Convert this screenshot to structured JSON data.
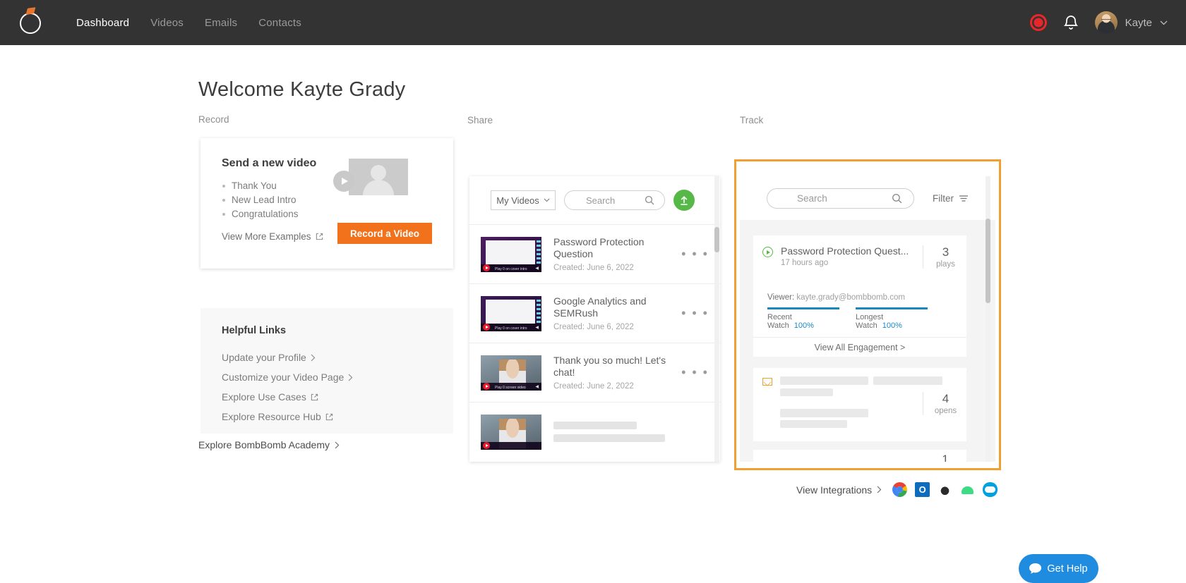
{
  "header": {
    "logo_name": "bombbomb-logo",
    "nav": [
      {
        "label": "Dashboard",
        "active": true
      },
      {
        "label": "Videos",
        "active": false
      },
      {
        "label": "Emails",
        "active": false
      },
      {
        "label": "Contacts",
        "active": false
      }
    ],
    "record_button_name": "record-button",
    "notifications_name": "notifications-bell",
    "user_name": "Kayte",
    "accent_color": "#e8272c",
    "background_color": "#333333"
  },
  "page": {
    "welcome_title": "Welcome Kayte Grady",
    "columns": {
      "record_label": "Record",
      "share_label": "Share",
      "track_label": "Track"
    }
  },
  "record": {
    "card_title": "Send a new video",
    "examples": [
      "Thank You",
      "New Lead Intro",
      "Congratulations"
    ],
    "view_more_label": "View More Examples",
    "record_button_label": "Record a Video",
    "record_button_color": "#f2721c",
    "helpful_links_title": "Helpful Links",
    "helpful_links": [
      {
        "label": "Update your Profile",
        "icon": "chevron-right"
      },
      {
        "label": "Customize your Video Page",
        "icon": "chevron-right"
      },
      {
        "label": "Explore Use Cases",
        "icon": "external-link"
      },
      {
        "label": "Explore Resource Hub",
        "icon": "external-link"
      }
    ]
  },
  "share": {
    "filter_dropdown": "My Videos",
    "search_placeholder": "Search",
    "upload_button_name": "upload-video-button",
    "upload_button_color": "#56b947",
    "videos": [
      {
        "title": "Password Protection Question",
        "created": "Created: June 6, 2022",
        "thumb": "t1",
        "thumb_caption": "Play 0 on cover intro"
      },
      {
        "title": "Google Analytics and SEMRush",
        "created": "Created: June 6, 2022",
        "thumb": "t2",
        "thumb_caption": "Play 0 on cover intro"
      },
      {
        "title": "Thank you so much! Let's chat!",
        "created": "Created: June 2, 2022",
        "thumb": "t3",
        "thumb_caption": "Play 0 screen video"
      }
    ],
    "menu_glyph": "• • •"
  },
  "track": {
    "search_placeholder": "Search",
    "filter_label": "Filter",
    "highlight_color": "#f0a030",
    "engagement": {
      "title": "Password Protection Quest...",
      "timestamp": "17 hours ago",
      "count": "3",
      "count_unit": "plays",
      "viewer_label": "Viewer:",
      "viewer_email": "kayte.grady@bombbomb.com",
      "metrics": [
        {
          "label": "Recent Watch",
          "value": "100%"
        },
        {
          "label": "Longest Watch",
          "value": "100%"
        }
      ],
      "bar_color": "#1b87c1",
      "view_all_label": "View All Engagement >"
    },
    "email_card": {
      "icon": "envelope-icon",
      "count": "4",
      "count_unit": "opens"
    },
    "third_card": {
      "count": "1"
    }
  },
  "footer": {
    "academy_label": "Explore BombBomb Academy",
    "integrations_label": "View Integrations",
    "integration_icons": [
      "chrome-icon",
      "outlook-icon",
      "apple-icon",
      "android-icon",
      "salesforce-icon"
    ]
  },
  "support": {
    "get_help_label": "Get Help",
    "color": "#1f8ce0"
  }
}
